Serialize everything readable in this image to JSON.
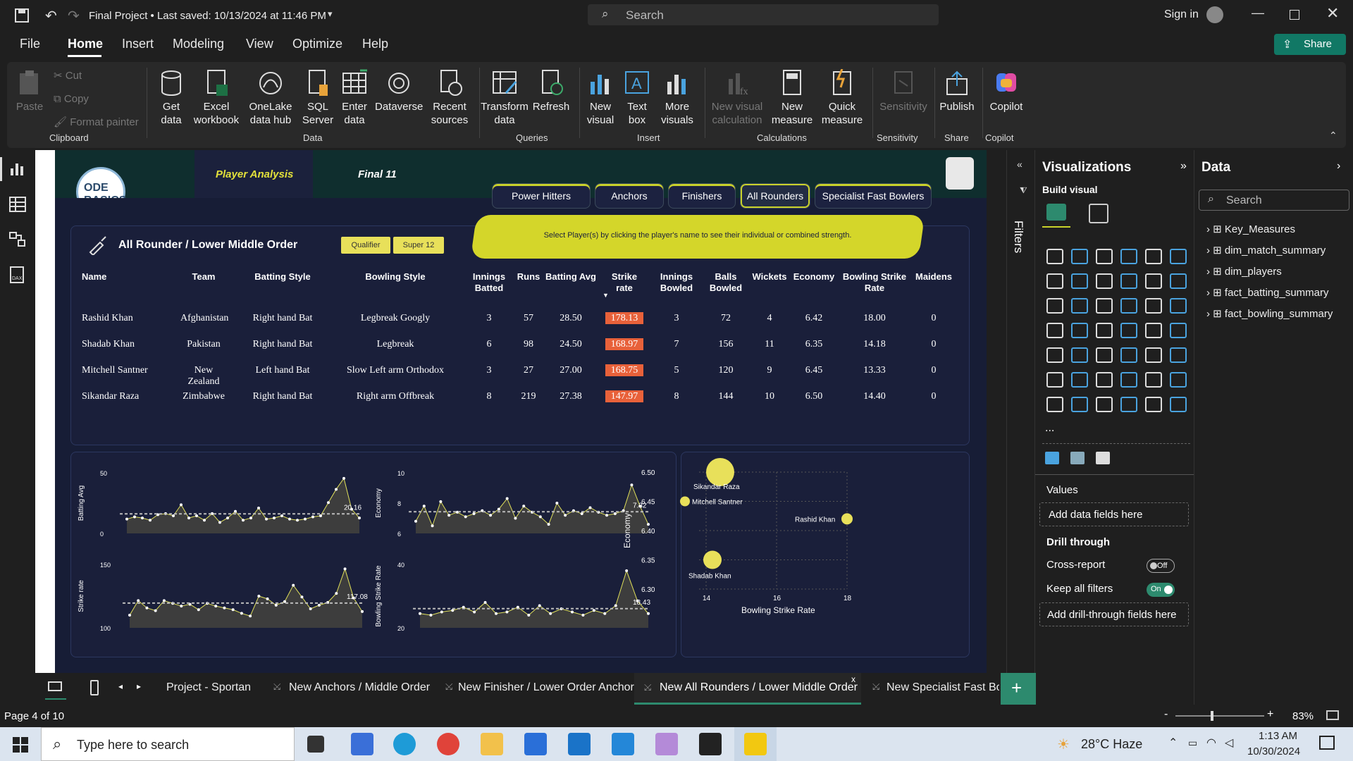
{
  "titlebar": {
    "title": "Final Project • Last saved: 10/13/2024 at 11:46 PM",
    "search_placeholder": "Search",
    "sign_in": "Sign in"
  },
  "menu": {
    "items": [
      "File",
      "Home",
      "Insert",
      "Modeling",
      "View",
      "Optimize",
      "Help"
    ],
    "share": "Share"
  },
  "ribbon": {
    "clipboard": {
      "paste": "Paste",
      "cut": "Cut",
      "copy": "Copy",
      "format_painter": "Format painter",
      "group": "Clipboard"
    },
    "data": {
      "get_data": "Get data",
      "excel": "Excel workbook",
      "onelake": "OneLake data hub",
      "sql": "SQL Server",
      "enter": "Enter data",
      "dataverse": "Dataverse",
      "recent": "Recent sources",
      "group": "Data"
    },
    "queries": {
      "transform": "Transform data",
      "refresh": "Refresh",
      "group": "Queries"
    },
    "insert": {
      "new_visual": "New visual",
      "text_box": "Text box",
      "more_visuals": "More visuals",
      "group": "Insert"
    },
    "calculations": {
      "new_visual_calc": "New visual calculation",
      "new_measure": "New measure",
      "quick_measure": "Quick measure",
      "group": "Calculations"
    },
    "sensitivity": {
      "label": "Sensitivity",
      "group": "Sensitivity"
    },
    "share": {
      "publish": "Publish",
      "group": "Share"
    },
    "copilot": {
      "label": "Copilot",
      "group": "Copilot"
    }
  },
  "report": {
    "logo_text": "ODE BASICS",
    "tab_player": "Player Analysis",
    "tab_final": "Final 11",
    "categories": [
      "Power Hitters",
      "Anchors",
      "Finishers",
      "All Rounders",
      "Specialist Fast Bowlers"
    ],
    "banner": "Select Player(s) by clicking the player's name to see their individual or combined strength.",
    "panel_title": "All Rounder / Lower Middle Order",
    "btn_qualifier": "Qualifier",
    "btn_super12": "Super 12",
    "columns": [
      "Name",
      "Team",
      "Batting Style",
      "Bowling Style",
      "Innings Batted",
      "Runs",
      "Batting Avg",
      "Strike rate",
      "Innings Bowled",
      "Balls Bowled",
      "Wickets",
      "Economy",
      "Bowling Strike Rate",
      "Maidens"
    ],
    "rows": [
      [
        "Rashid Khan",
        "Afghanistan",
        "Right hand Bat",
        "Legbreak Googly",
        "3",
        "57",
        "28.50",
        "178.13",
        "3",
        "72",
        "4",
        "6.42",
        "18.00",
        "0"
      ],
      [
        "Shadab Khan",
        "Pakistan",
        "Right hand Bat",
        "Legbreak",
        "6",
        "98",
        "24.50",
        "168.97",
        "7",
        "156",
        "11",
        "6.35",
        "14.18",
        "0"
      ],
      [
        "Mitchell Santner",
        "New Zealand",
        "Left hand Bat",
        "Slow Left arm Orthodox",
        "3",
        "27",
        "27.00",
        "168.75",
        "5",
        "120",
        "9",
        "6.45",
        "13.33",
        "0"
      ],
      [
        "Sikandar Raza",
        "Zimbabwe",
        "Right hand Bat",
        "Right arm Offbreak",
        "8",
        "219",
        "27.38",
        "147.97",
        "8",
        "144",
        "10",
        "6.50",
        "14.40",
        "0"
      ]
    ]
  },
  "chart_data": [
    {
      "type": "area",
      "ylabel": "Batting Avg",
      "yticks": [
        "50",
        "0"
      ],
      "avg_label": "20.16",
      "values": [
        13,
        15,
        14,
        12,
        17,
        18,
        16,
        26,
        14,
        16,
        12,
        18,
        10,
        14,
        20,
        12,
        14,
        23,
        13,
        14,
        16,
        13,
        12,
        13,
        15,
        16,
        28,
        40,
        50,
        22,
        14
      ]
    },
    {
      "type": "area",
      "ylabel": "Economy",
      "yticks": [
        "10",
        "8",
        "6"
      ],
      "avg_label": "7.32",
      "values": [
        6.8,
        7.8,
        6.5,
        8.1,
        7.2,
        7.4,
        7.1,
        7.3,
        7.5,
        7.2,
        7.6,
        8.3,
        7.0,
        7.8,
        7.4,
        7.1,
        6.6,
        8.0,
        7.2,
        7.5,
        7.3,
        7.7,
        7.4,
        7.2,
        7.3,
        7.5,
        9.2,
        7.8,
        6.6
      ]
    },
    {
      "type": "area",
      "ylabel": "Strike rate",
      "yticks": [
        "150",
        "100"
      ],
      "avg_label": "117.08",
      "values": [
        104,
        120,
        112,
        109,
        120,
        117,
        114,
        116,
        110,
        117,
        114,
        112,
        110,
        106,
        103,
        125,
        122,
        115,
        119,
        137,
        124,
        111,
        115,
        118,
        128,
        155,
        123,
        108
      ]
    },
    {
      "type": "area",
      "ylabel": "Bowling Strike Rate",
      "yticks": [
        "40",
        "20"
      ],
      "avg_label": "18.43",
      "values": [
        19,
        18,
        20,
        21,
        23,
        20,
        26,
        19,
        20,
        23,
        18,
        24,
        19,
        22,
        20,
        18,
        21,
        19,
        24,
        46,
        27,
        19
      ]
    },
    {
      "type": "scatter",
      "xlabel": "Bowling Strike Rate",
      "ylabel": "Economy",
      "xticks": [
        "14",
        "16",
        "18"
      ],
      "yticks": [
        "6.50",
        "6.45",
        "6.40",
        "6.35",
        "6.30"
      ],
      "xlim": [
        14,
        18
      ],
      "ylim": [
        6.3,
        6.5
      ],
      "points": [
        {
          "name": "Sikandar Raza",
          "x": 14.4,
          "y": 6.5
        },
        {
          "name": "Mitchell Santner",
          "x": 13.33,
          "y": 6.45
        },
        {
          "name": "Rashid Khan",
          "x": 18.0,
          "y": 6.42
        },
        {
          "name": "Shadab Khan",
          "x": 14.18,
          "y": 6.35
        }
      ]
    }
  ],
  "filters": {
    "label": "Filters"
  },
  "viz": {
    "title": "Visualizations",
    "build": "Build visual",
    "values": "Values",
    "add_data": "Add data fields here",
    "drill": "Drill through",
    "cross": "Cross-report",
    "cross_state": "Off",
    "keep": "Keep all filters",
    "keep_state": "On",
    "add_drill": "Add drill-through fields here",
    "more": "..."
  },
  "data": {
    "title": "Data",
    "search_placeholder": "Search",
    "tables": [
      "Key_Measures",
      "dim_match_summary",
      "dim_players",
      "fact_batting_summary",
      "fact_bowling_summary"
    ]
  },
  "page_tabs": [
    "Project - Sportan",
    "New Anchors / Middle Order",
    "New Finisher / Lower Order Anchor",
    "New All Rounders / Lower Middle Order",
    "New Specialist Fast Bowl"
  ],
  "status": {
    "page": "Page 4 of 10",
    "zoom": "83%"
  },
  "taskbar": {
    "search": "Type here to search",
    "weather": "28°C  Haze",
    "time": "1:13 AM",
    "date": "10/30/2024"
  }
}
